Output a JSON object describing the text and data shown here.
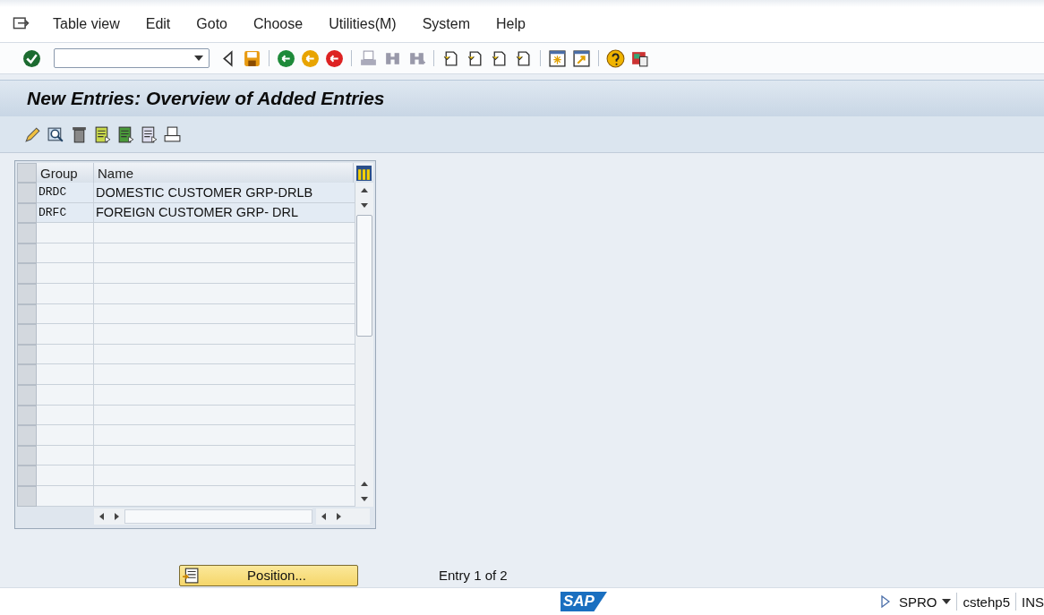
{
  "menu": [
    "Table view",
    "Edit",
    "Goto",
    "Choose",
    "Utilities(M)",
    "System",
    "Help"
  ],
  "title": "New Entries: Overview of Added Entries",
  "table": {
    "columns": [
      "Group",
      "Name"
    ],
    "rows": [
      {
        "group": "DRDC",
        "name": "DOMESTIC CUSTOMER GRP-DRLB"
      },
      {
        "group": "DRFC",
        "name": "FOREIGN CUSTOMER GRP- DRL"
      }
    ]
  },
  "position_button": "Position...",
  "entry_info": "Entry 1 of 2",
  "status_bar": {
    "logo": "SAP",
    "transaction": "SPRO",
    "server": "cstehp5",
    "mode": "INS"
  }
}
